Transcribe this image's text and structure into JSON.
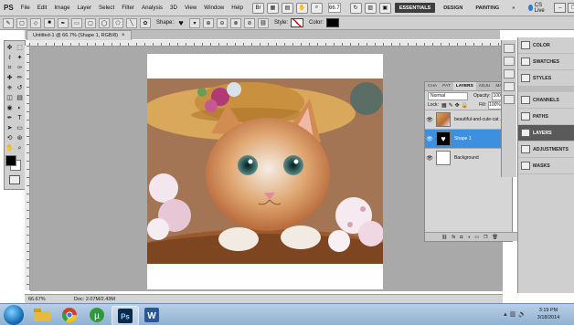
{
  "app": {
    "logo_text": "PS"
  },
  "menu": {
    "items": [
      "File",
      "Edit",
      "Image",
      "Layer",
      "Select",
      "Filter",
      "Analysis",
      "3D",
      "View",
      "Window",
      "Help"
    ],
    "zoom": "66.7",
    "workspaces": [
      "ESSENTIALS",
      "DESIGN",
      "PAINTING"
    ],
    "more": "»",
    "cs_live": "CS Live"
  },
  "options_bar": {
    "shape_label": "Shape:",
    "style_label": "Style:",
    "color_label": "Color:",
    "shape_glyph": "♥"
  },
  "document": {
    "tab_label": "Untitled-1 @ 66.7% (Shape 1, RGB/8)",
    "status_zoom": "66.67%",
    "status_doc": "Doc: 2.07M/2.43M"
  },
  "layers_panel": {
    "tabs": [
      "CHA",
      "PAT",
      "LAYERS",
      "ADJU",
      "MAS"
    ],
    "blend_mode": "Normal",
    "opacity_label": "Opacity:",
    "opacity_value": "100%",
    "lock_label": "Lock:",
    "fill_label": "Fill:",
    "fill_value": "100%",
    "layers": [
      {
        "name": "beautiful-and-cute-cat ...",
        "selected": false
      },
      {
        "name": "Shape 1",
        "selected": true
      },
      {
        "name": "Background",
        "selected": false
      }
    ]
  },
  "dock": {
    "items": [
      "COLOR",
      "SWATCHES",
      "STYLES",
      "CHANNELS",
      "PATHS",
      "LAYERS",
      "ADJUSTMENTS",
      "MASKS"
    ],
    "active": "LAYERS"
  },
  "taskbar": {
    "time": "3:19 PM",
    "date": "3/18/2014"
  },
  "colors": {
    "accent": "#3d8fe0",
    "ui_gray": "#cfcfcf",
    "pasteboard": "#a9a9a9"
  }
}
